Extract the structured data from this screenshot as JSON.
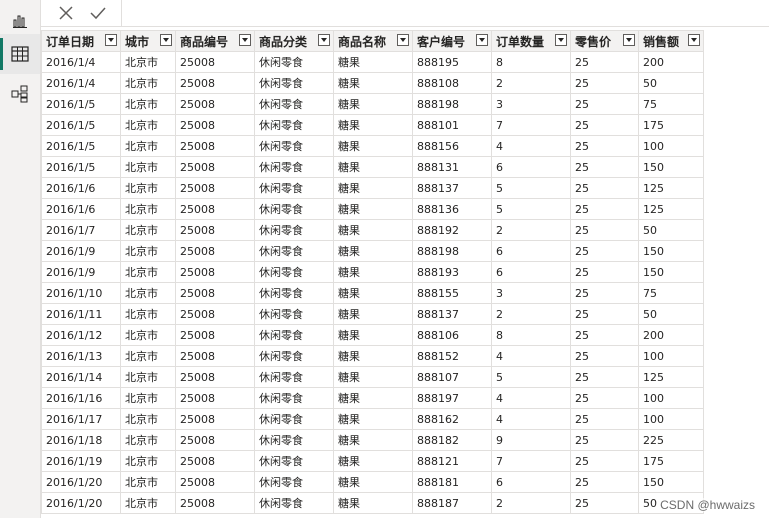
{
  "colors": {
    "accent": "#117865",
    "header_bg": "#f3f2f1",
    "grid": "#e1dfdd"
  },
  "sidebar": {
    "items": [
      {
        "icon": "report-view-icon"
      },
      {
        "icon": "data-view-icon",
        "active": true
      },
      {
        "icon": "model-view-icon"
      }
    ]
  },
  "editbar": {
    "cancel_icon": "close-icon",
    "commit_icon": "check-icon"
  },
  "table": {
    "columns": [
      "订单日期",
      "城市",
      "商品编号",
      "商品分类",
      "商品名称",
      "客户编号",
      "订单数量",
      "零售价",
      "销售额"
    ],
    "rows": [
      [
        "2016/1/4",
        "北京市",
        "25008",
        "休闲零食",
        "糖果",
        "888195",
        "8",
        "25",
        "200"
      ],
      [
        "2016/1/4",
        "北京市",
        "25008",
        "休闲零食",
        "糖果",
        "888108",
        "2",
        "25",
        "50"
      ],
      [
        "2016/1/5",
        "北京市",
        "25008",
        "休闲零食",
        "糖果",
        "888198",
        "3",
        "25",
        "75"
      ],
      [
        "2016/1/5",
        "北京市",
        "25008",
        "休闲零食",
        "糖果",
        "888101",
        "7",
        "25",
        "175"
      ],
      [
        "2016/1/5",
        "北京市",
        "25008",
        "休闲零食",
        "糖果",
        "888156",
        "4",
        "25",
        "100"
      ],
      [
        "2016/1/5",
        "北京市",
        "25008",
        "休闲零食",
        "糖果",
        "888131",
        "6",
        "25",
        "150"
      ],
      [
        "2016/1/6",
        "北京市",
        "25008",
        "休闲零食",
        "糖果",
        "888137",
        "5",
        "25",
        "125"
      ],
      [
        "2016/1/6",
        "北京市",
        "25008",
        "休闲零食",
        "糖果",
        "888136",
        "5",
        "25",
        "125"
      ],
      [
        "2016/1/7",
        "北京市",
        "25008",
        "休闲零食",
        "糖果",
        "888192",
        "2",
        "25",
        "50"
      ],
      [
        "2016/1/9",
        "北京市",
        "25008",
        "休闲零食",
        "糖果",
        "888198",
        "6",
        "25",
        "150"
      ],
      [
        "2016/1/9",
        "北京市",
        "25008",
        "休闲零食",
        "糖果",
        "888193",
        "6",
        "25",
        "150"
      ],
      [
        "2016/1/10",
        "北京市",
        "25008",
        "休闲零食",
        "糖果",
        "888155",
        "3",
        "25",
        "75"
      ],
      [
        "2016/1/11",
        "北京市",
        "25008",
        "休闲零食",
        "糖果",
        "888137",
        "2",
        "25",
        "50"
      ],
      [
        "2016/1/12",
        "北京市",
        "25008",
        "休闲零食",
        "糖果",
        "888106",
        "8",
        "25",
        "200"
      ],
      [
        "2016/1/13",
        "北京市",
        "25008",
        "休闲零食",
        "糖果",
        "888152",
        "4",
        "25",
        "100"
      ],
      [
        "2016/1/14",
        "北京市",
        "25008",
        "休闲零食",
        "糖果",
        "888107",
        "5",
        "25",
        "125"
      ],
      [
        "2016/1/16",
        "北京市",
        "25008",
        "休闲零食",
        "糖果",
        "888197",
        "4",
        "25",
        "100"
      ],
      [
        "2016/1/17",
        "北京市",
        "25008",
        "休闲零食",
        "糖果",
        "888162",
        "4",
        "25",
        "100"
      ],
      [
        "2016/1/18",
        "北京市",
        "25008",
        "休闲零食",
        "糖果",
        "888182",
        "9",
        "25",
        "225"
      ],
      [
        "2016/1/19",
        "北京市",
        "25008",
        "休闲零食",
        "糖果",
        "888121",
        "7",
        "25",
        "175"
      ],
      [
        "2016/1/20",
        "北京市",
        "25008",
        "休闲零食",
        "糖果",
        "888181",
        "6",
        "25",
        "150"
      ],
      [
        "2016/1/20",
        "北京市",
        "25008",
        "休闲零食",
        "糖果",
        "888187",
        "2",
        "25",
        "50"
      ]
    ]
  },
  "watermark": "CSDN @hwwaizs"
}
